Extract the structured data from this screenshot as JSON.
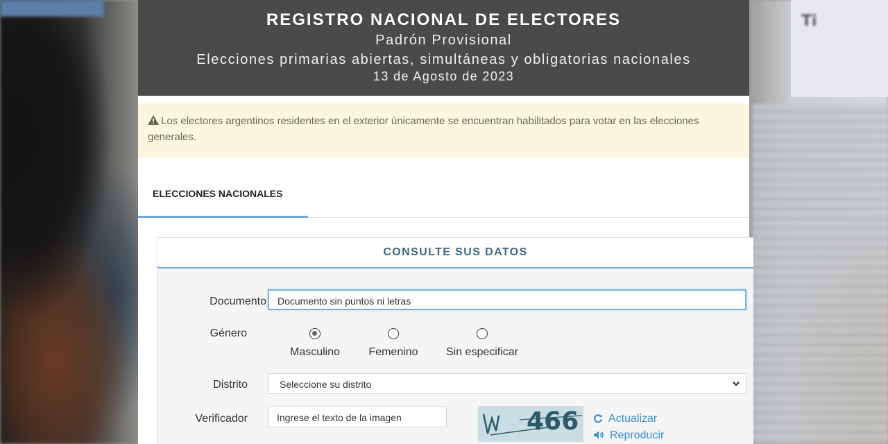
{
  "header": {
    "title": "REGISTRO NACIONAL DE ELECTORES",
    "subtitle": "Padrón Provisional",
    "election": "Elecciones primarias abiertas, simultáneas y obligatorias nacionales",
    "date": "13 de Agosto de 2023"
  },
  "alert": {
    "icon": "warning-icon",
    "text": "Los electores argentinos residentes en el exterior únicamente se encuentran habilitados para votar en las elecciones generales."
  },
  "tabs": [
    {
      "label": "ELECCIONES NACIONALES",
      "active": true
    }
  ],
  "form": {
    "title": "CONSULTE SUS DATOS",
    "documento": {
      "label": "Documento",
      "value": "Documento sin puntos ni letras"
    },
    "genero": {
      "label": "Género",
      "options": [
        {
          "label": "Masculino",
          "checked": true
        },
        {
          "label": "Femenino",
          "checked": false
        },
        {
          "label": "Sin especificar",
          "checked": false
        }
      ]
    },
    "distrito": {
      "label": "Distrito",
      "selected": "Seleccione su distrito"
    },
    "verificador": {
      "label": "Verificador",
      "placeholder": "Ingrese el texto de la imagen",
      "captcha_text": "466",
      "refresh_label": "Actualizar",
      "play_label": "Reproducir"
    }
  },
  "background": {
    "paper_text": "Ti"
  },
  "colors": {
    "header_bg": "#4a4a4a",
    "alert_bg": "#fcf6e1",
    "accent": "#6ea8d8",
    "link": "#3a8fd3",
    "card_title": "#3e6880"
  }
}
